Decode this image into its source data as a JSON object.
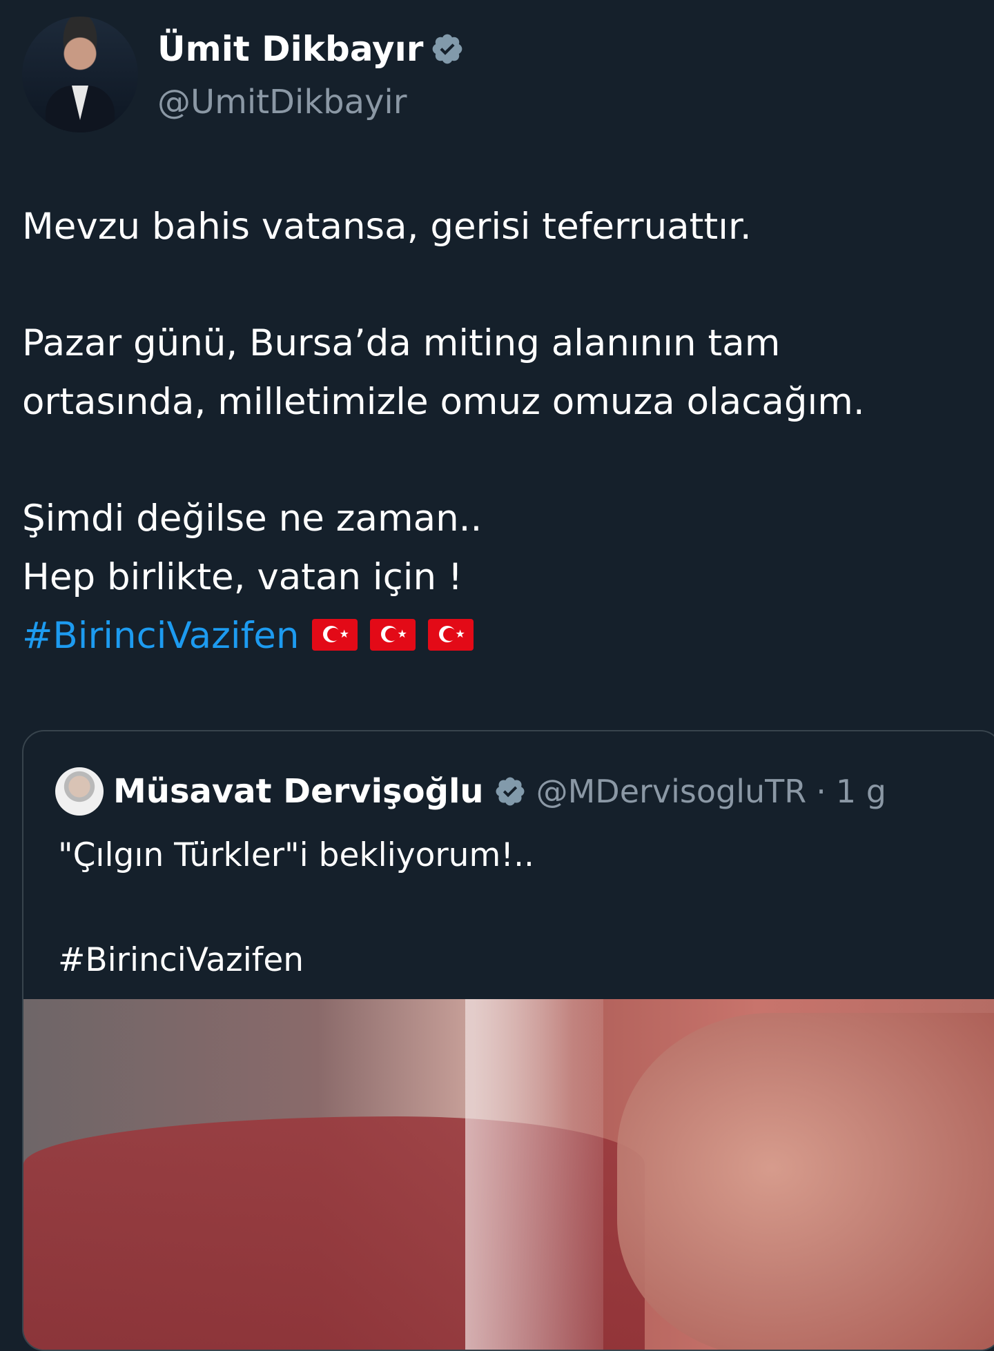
{
  "author": {
    "name": "Ümit Dikbayır",
    "handle": "@UmitDikbayir",
    "verified_icon": "verified-badge-icon"
  },
  "tweet": {
    "lines": [
      "Mevzu bahis vatansa, gerisi teferruattır.",
      "Pazar günü, Bursa’da miting alanının tam",
      "ortasında, milletimizle omuz omuza olacağım.",
      "Şimdi değilse ne zaman..",
      "Hep birlikte, vatan için !"
    ],
    "hashtag": "#BirinciVazifen",
    "emoji": [
      "turkey-flag-icon",
      "turkey-flag-icon",
      "turkey-flag-icon"
    ]
  },
  "quoted_tweet": {
    "name": "Müsavat Dervişoğlu",
    "handle": "@MDervisogluTR",
    "separator": "·",
    "time": "1 g",
    "text_line": "\"Çılgın Türkler\"i bekliyorum!..",
    "hashtag": "#BirinciVazifen"
  },
  "colors": {
    "background": "#15202b",
    "link": "#1d9bf0",
    "secondary_text": "#8b98a5",
    "border": "#38444d"
  }
}
